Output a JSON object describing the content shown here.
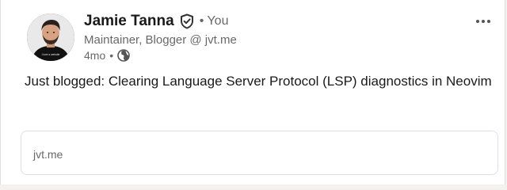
{
  "post": {
    "author": {
      "name": "Jamie Tanna",
      "degree": "• You",
      "headline": "Maintainer, Blogger @ jvt.me",
      "age": "4mo",
      "separator": "•",
      "avatar_shirt_text": "I love a website"
    },
    "text": "Just blogged: Clearing Language Server Protocol (LSP) diagnostics in Neovim",
    "link_preview": {
      "domain": "jvt.me"
    }
  },
  "icons": {
    "verified": "verified-shield-icon",
    "visibility": "globe-icon",
    "menu": "more-horizontal-icon"
  },
  "colors": {
    "primary_text": "#191919",
    "secondary_text": "#666666",
    "border": "#e0dfdc",
    "page_background": "#f4f2ee"
  }
}
